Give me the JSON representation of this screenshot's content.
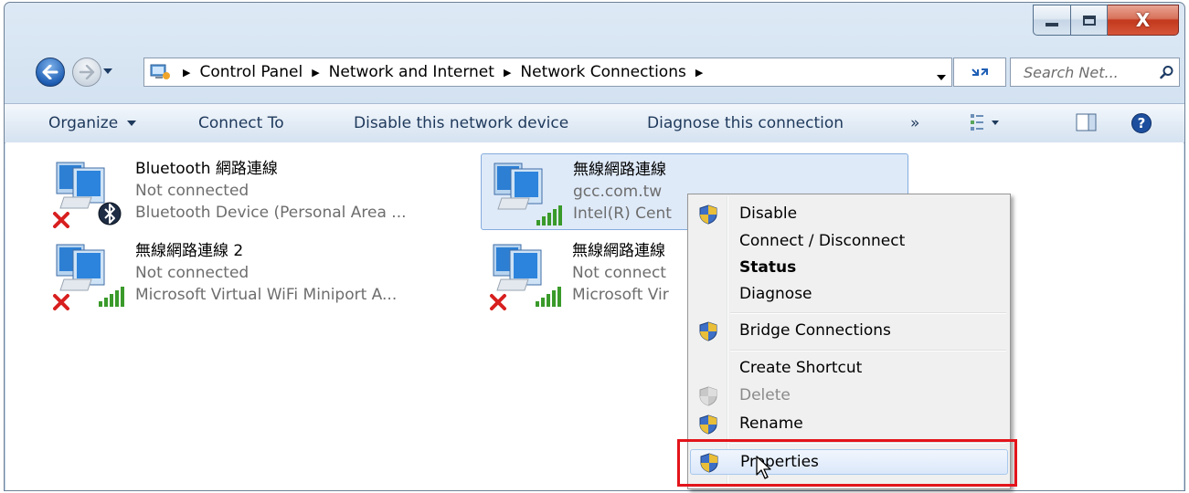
{
  "window": {
    "caption_buttons": [
      {
        "name": "minimize",
        "icon": "minimize-icon"
      },
      {
        "name": "maximize",
        "icon": "maximize-icon"
      },
      {
        "name": "close",
        "icon": "close-icon",
        "glyph": "X"
      }
    ]
  },
  "address_bar": {
    "breadcrumbs": [
      "Control Panel",
      "Network and Internet",
      "Network Connections"
    ],
    "search_placeholder": "Search Net..."
  },
  "command_bar": {
    "organize": "Organize",
    "connect_to": "Connect To",
    "disable_device": "Disable this network device",
    "diagnose": "Diagnose this connection",
    "overflow": "»"
  },
  "connections": [
    {
      "name": "Bluetooth 網路連線",
      "status": "Not connected",
      "device": "Bluetooth Device (Personal Area ...",
      "badge": "bluetooth-icon",
      "disconnected": true,
      "selected": false
    },
    {
      "name": "無線網路連線",
      "status": "gcc.com.tw",
      "device": "Intel(R) Cent",
      "badge": "signal-bars-icon",
      "disconnected": false,
      "selected": true
    },
    {
      "name": "無線網路連線 2",
      "status": "Not connected",
      "device": "Microsoft Virtual WiFi Miniport A...",
      "badge": "signal-bars-icon",
      "disconnected": true,
      "selected": false
    },
    {
      "name": "無線網路連線",
      "status": "Not connect",
      "device": "Microsoft Vir",
      "badge": "signal-bars-icon",
      "disconnected": true,
      "selected": false
    }
  ],
  "context_menu": {
    "items": [
      {
        "label": "Disable",
        "shield": true
      },
      {
        "label": "Connect / Disconnect",
        "shield": false
      },
      {
        "label": "Status",
        "shield": false,
        "bold": true
      },
      {
        "label": "Diagnose",
        "shield": false
      },
      {
        "label": "Bridge Connections",
        "shield": true
      },
      {
        "label": "Create Shortcut",
        "shield": false
      },
      {
        "label": "Delete",
        "shield": true,
        "disabled": true
      },
      {
        "label": "Rename",
        "shield": true
      },
      {
        "label": "Properties",
        "shield": true,
        "hovered": true
      }
    ]
  },
  "colors": {
    "highlight_box": "#e3141b",
    "selection_fill": "#dfeaf9",
    "command_text": "#1e395b"
  }
}
